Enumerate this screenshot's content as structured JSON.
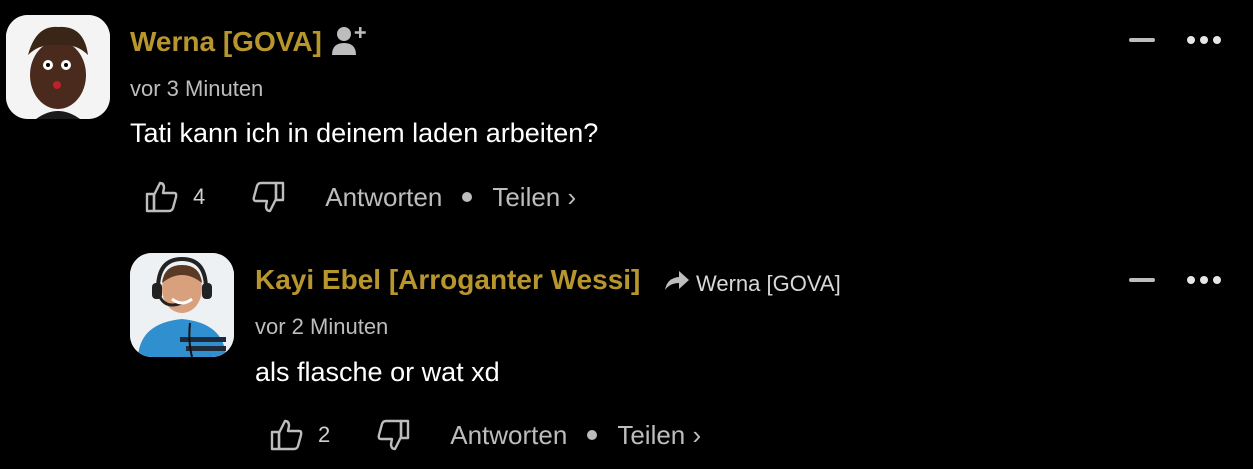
{
  "colors": {
    "author": "#b8962e",
    "muted": "#bdbdbd",
    "background": "#000000"
  },
  "comments": [
    {
      "author": "Werna [GOVA]",
      "time": "vor 3 Minuten",
      "text": "Tati kann ich in deinem laden arbeiten?",
      "likes": "4",
      "reply_label": "Antworten",
      "share_label": "Teilen ›",
      "icons": [
        "add-friend-icon",
        "thumbs-up-icon",
        "thumbs-down-icon",
        "collapse-icon",
        "more-icon"
      ]
    },
    {
      "author": "Kayi Ebel [Arroganter Wessi]",
      "reply_to": "Werna [GOVA]",
      "time": "vor 2 Minuten",
      "text": "als flasche or wat xd",
      "likes": "2",
      "reply_label": "Antworten",
      "share_label": "Teilen ›",
      "icons": [
        "reply-arrow-icon",
        "thumbs-up-icon",
        "thumbs-down-icon",
        "collapse-icon",
        "more-icon"
      ]
    }
  ]
}
